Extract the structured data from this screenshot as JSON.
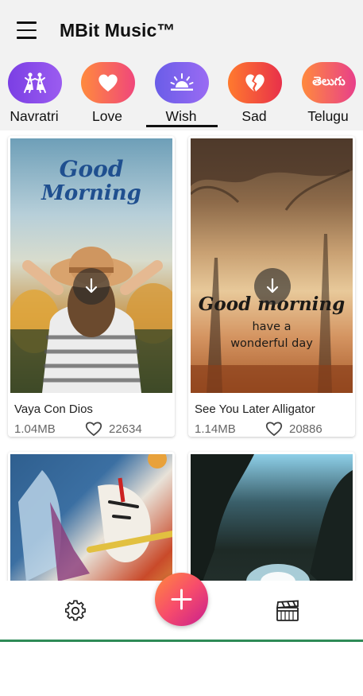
{
  "header": {
    "title": "MBit Music™",
    "menu_icon": "hamburger-menu-icon"
  },
  "categories": [
    {
      "label": "Navratri",
      "icon": "dancers-icon",
      "gradient": [
        "#7b3fe4",
        "#9b5cf0"
      ]
    },
    {
      "label": "Love",
      "icon": "heart-icon",
      "gradient": [
        "#ff8a3d",
        "#f0477b"
      ]
    },
    {
      "label": "Wish",
      "icon": "sunrise-icon",
      "gradient": [
        "#6a5de8",
        "#9a6bf3"
      ],
      "selected": true
    },
    {
      "label": "Sad",
      "icon": "broken-heart-icon",
      "gradient": [
        "#ff7a2e",
        "#e8304a"
      ]
    },
    {
      "label": "Telugu",
      "icon": "telugu-script-icon",
      "icon_text": "తెలుగు",
      "gradient": [
        "#ff8a3d",
        "#e83f8a"
      ]
    }
  ],
  "cards": [
    {
      "title": "Vaya Con Dios",
      "size": "1.04MB",
      "likes": "22634",
      "thumb_line1": "Good",
      "thumb_line2": "Morning"
    },
    {
      "title": "See You Later Alligator",
      "size": "1.14MB",
      "likes": "20886",
      "thumb_line1": "Good morning",
      "thumb_line2": "have a",
      "thumb_line3": "wonderful day"
    },
    {
      "title": "",
      "size": "",
      "likes": ""
    },
    {
      "title": "",
      "size": "",
      "likes": ""
    }
  ],
  "bottom_bar": {
    "settings_icon": "settings-gear-icon",
    "create_icon": "plus-icon",
    "videos_icon": "clapperboard-icon"
  },
  "colors": {
    "accent_green": "#2e8b57",
    "fab_gradient": [
      "#ff8a3d",
      "#f74c6b",
      "#c81f8e"
    ]
  }
}
